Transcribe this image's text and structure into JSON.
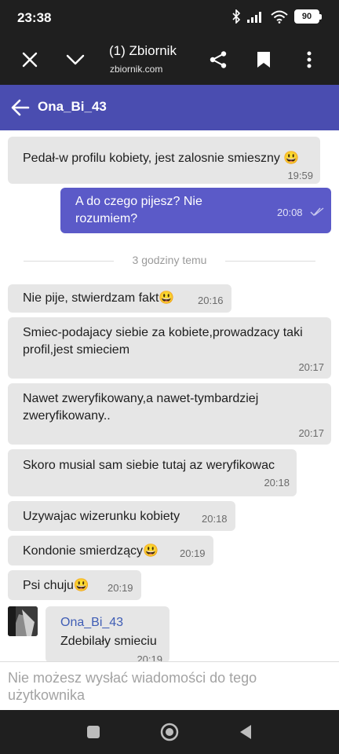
{
  "status_bar": {
    "time": "23:38",
    "battery": "90",
    "icons": [
      "bluetooth-icon",
      "signal-icon",
      "wifi-icon",
      "battery-icon"
    ]
  },
  "browser": {
    "page_title": "(1) Zbiornik",
    "url": "zbiornik.com",
    "icons": [
      "close-icon",
      "chevron-down-icon",
      "share-icon",
      "bookmark-icon",
      "more-vertical-icon"
    ]
  },
  "chat": {
    "contact_name": "Ona_Bi_43",
    "accent_color": "#4a4db0",
    "messages": [
      {
        "text": "Pedał-w profilu kobiety, jest zalosnie smieszny 😃",
        "time": "19:59",
        "direction": "in"
      },
      {
        "text": "A do czego pijesz? Nie rozumiem?",
        "time": "20:08",
        "direction": "out",
        "status": "read"
      },
      {
        "text": "Nie pije, stwierdzam fakt😃",
        "time": "20:16",
        "direction": "in"
      },
      {
        "text": "Smiec-podajacy siebie za kobiete,prowadzacy taki profil,jest smieciem",
        "time": "20:17",
        "direction": "in"
      },
      {
        "text": "Nawet zweryfikowany,a nawet-tymbardziej zweryfikowany..",
        "time": "20:17",
        "direction": "in"
      },
      {
        "text": "Skoro musial sam siebie tutaj az weryfikowac",
        "time": "20:18",
        "direction": "in"
      },
      {
        "text": "Uzywajac wizerunku kobiety",
        "time": "20:18",
        "direction": "in"
      },
      {
        "text": "Kondonie smierdzący😃",
        "time": "20:19",
        "direction": "in"
      },
      {
        "text": "Psi chuju😃",
        "time": "20:19",
        "direction": "in"
      },
      {
        "sender": "Ona_Bi_43",
        "text": "Zdebilały smieciu",
        "time": "20:19",
        "direction": "in"
      }
    ],
    "divider_label": "3 godziny temu",
    "input_placeholder": "Nie możesz wysłać wiadomości do tego użytkownika"
  },
  "nav_bar": {
    "icons": [
      "recents-icon",
      "home-icon",
      "back-icon"
    ]
  }
}
